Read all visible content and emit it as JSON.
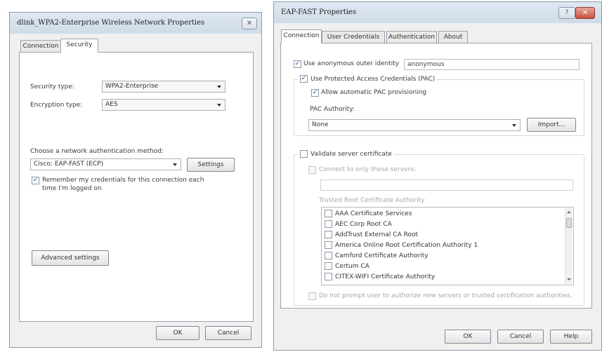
{
  "left_dialog": {
    "title": "dlink_WPA2-Enterprise Wireless Network Properties",
    "close_glyph": "✕",
    "tabs": [
      "Connection",
      "Security"
    ],
    "security_type_label": "Security type:",
    "security_type_value": "WPA2-Enterprise",
    "encryption_type_label": "Encryption type:",
    "encryption_type_value": "AES",
    "auth_method_label": "Choose a network authentication method:",
    "auth_method_value": "Cisco: EAP-FAST (ECP)",
    "settings_button": "Settings",
    "remember_line1": "Remember my credentials for this connection each",
    "remember_line2": "time I'm logged on",
    "remember_checked": true,
    "advanced_button": "Advanced settings",
    "ok_button": "OK",
    "cancel_button": "Cancel"
  },
  "right_dialog": {
    "title": "EAP-FAST Properties",
    "help_glyph": "?",
    "close_glyph": "✕",
    "tabs": [
      "Connection",
      "User Credentials",
      "Authentication",
      "About"
    ],
    "use_anonymous_label": "Use anonymous outer identity",
    "anonymous_value": "anonymous",
    "use_pac_label": "Use Protected Access Credentials (PAC)",
    "allow_auto_pac_label": "Allow automatic PAC provisioning",
    "pac_authority_label": "PAC Authority:",
    "pac_authority_value": "None",
    "import_button": "Import...",
    "validate_cert_label": "Validate server certificate",
    "connect_only_label": "Connect to only these servers:",
    "connect_only_value": "",
    "trusted_root_label": "Trusted Root Certificate Authority",
    "certificates": [
      "AAA Certificate Services",
      "AEC Corp Root CA",
      "AddTrust External CA Root",
      "America Online Root Certification Authority 1",
      "Camford Certificate Authority",
      "Certum CA",
      "CITEX-WIFI Certificate Authority"
    ],
    "do_not_prompt_label": "Do not prompt user to authorize new servers or trusted certification authorities.",
    "ok_button": "OK",
    "cancel_button": "Cancel",
    "help_button": "Help",
    "check_glyph": "✓"
  },
  "colors": {
    "window_bg": "#f0f0f0",
    "titlebar": "#d8e3ef",
    "close_red": "#c9513c",
    "disabled_text": "#a6a6a6"
  }
}
